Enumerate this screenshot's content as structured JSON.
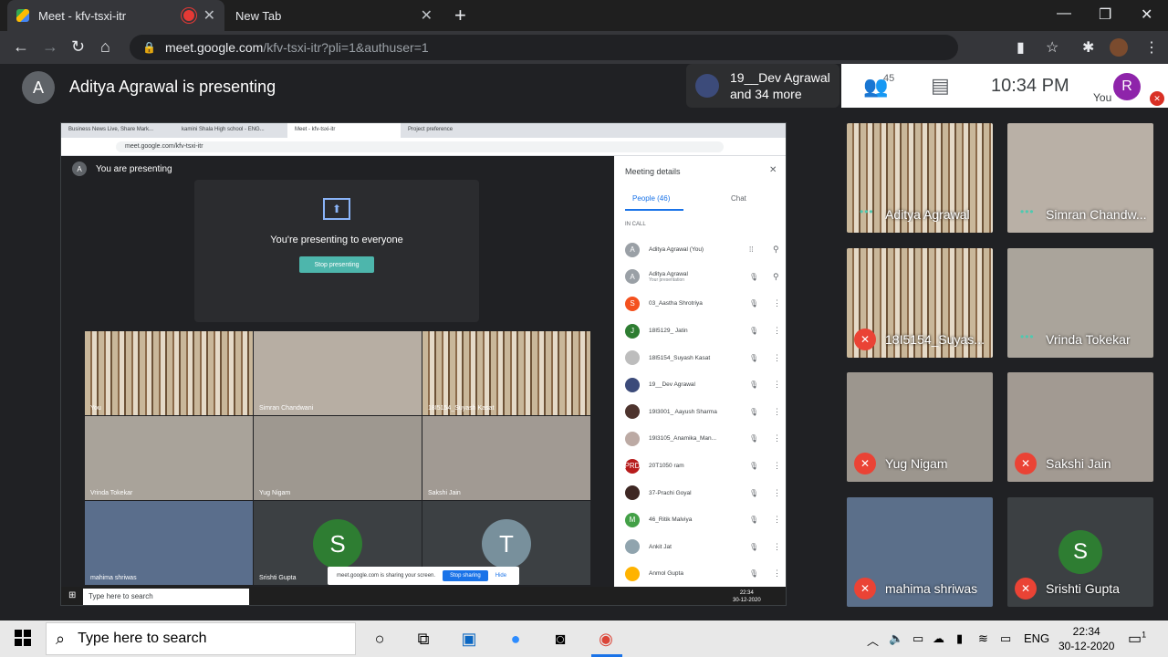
{
  "browser": {
    "tabs": [
      {
        "label": "Meet - kfv-tsxi-itr"
      },
      {
        "label": "New Tab"
      }
    ],
    "new_tab_glyph": "+",
    "url_host": "meet.google.com",
    "url_path": "/kfv-tsxi-itr?pli=1&authuser=1"
  },
  "meet": {
    "presenter_initial": "A",
    "presenting_title": "Aditya Agrawal is presenting",
    "presenter_pill_line1": "19__Dev Agrawal",
    "presenter_pill_line2": "and 34 more",
    "people_count": "45",
    "clock": "10:34 PM",
    "you_label": "You",
    "me_initial": "R"
  },
  "shared_screen": {
    "tabs": [
      "Business News Live, Share Mark...",
      "kamini Shala High school - ENG...",
      "Meet - kfv-tsxi-itr",
      "Project preference"
    ],
    "url": "meet.google.com/kfv-tsxi-itr",
    "you_are_presenting": "You are presenting",
    "you_initial": "A",
    "presenting_to_everyone": "You're presenting to everyone",
    "stop_presenting": "Stop presenting",
    "grid": [
      {
        "label": "You"
      },
      {
        "label": "Simran Chandwani"
      },
      {
        "label": "18I5154_Suyash Kasat"
      },
      {
        "label": "Vrinda Tokekar"
      },
      {
        "label": "Yug Nigam"
      },
      {
        "label": "Sakshi Jain"
      },
      {
        "label": "mahima shriwas"
      },
      {
        "label": "Srishti Gupta",
        "initial": "S"
      },
      {
        "label": "",
        "initial": "T"
      }
    ],
    "sharing_notice": "meet.google.com is sharing your screen.",
    "stop_sharing": "Stop sharing",
    "hide": "Hide",
    "panel": {
      "title": "Meeting details",
      "people_tab": "People (46)",
      "chat_tab": "Chat",
      "in_call": "IN CALL",
      "people": [
        {
          "name": "Aditya Agrawal (You)",
          "sub": "",
          "initial": "A",
          "color": "#9aa0a6"
        },
        {
          "name": "Aditya Agrawal",
          "sub": "Your presentation",
          "initial": "A",
          "color": "#9aa0a6"
        },
        {
          "name": "03_Aastha Shrotriya",
          "sub": "",
          "initial": "S",
          "color": "#f4511e"
        },
        {
          "name": "18I5129_ Jatin",
          "sub": "",
          "initial": "J",
          "color": "#2e7d32"
        },
        {
          "name": "18I5154_Suyash Kasat",
          "sub": "",
          "initial": "",
          "color": "#bdbdbd"
        },
        {
          "name": "19__Dev Agrawal",
          "sub": "",
          "initial": "",
          "color": "#3c4b7a"
        },
        {
          "name": "19I3001_ Aayush Sharma",
          "sub": "",
          "initial": "",
          "color": "#4e342e"
        },
        {
          "name": "19I3105_Anamika_Man...",
          "sub": "",
          "initial": "",
          "color": "#bcaaa4"
        },
        {
          "name": "20T1050 ram",
          "sub": "",
          "initial": "PRD",
          "color": "#b71c1c"
        },
        {
          "name": "37-Prachi Goyal",
          "sub": "",
          "initial": "",
          "color": "#3e2723"
        },
        {
          "name": "46_Ritik Malviya",
          "sub": "",
          "initial": "M",
          "color": "#43a047"
        },
        {
          "name": "Ankit Jat",
          "sub": "",
          "initial": "",
          "color": "#90a4ae"
        },
        {
          "name": "Anmol Gupta",
          "sub": "",
          "initial": "",
          "color": "#ffb300"
        }
      ]
    },
    "taskbar_search": "Type here to search",
    "clock_time": "22:34",
    "clock_date": "30-12-2020"
  },
  "tiles": [
    {
      "name": "Aditya Agrawal",
      "speaking": true
    },
    {
      "name": "Simran Chandw...",
      "speaking": true
    },
    {
      "name": "18I5154_Suyas...",
      "muted": true
    },
    {
      "name": "Vrinda Tokekar",
      "speaking": true
    },
    {
      "name": "Yug Nigam",
      "muted": true
    },
    {
      "name": "Sakshi Jain",
      "muted": true
    },
    {
      "name": "mahima shriwas",
      "muted": true
    },
    {
      "name": "Srishti Gupta",
      "muted": true,
      "initial": "S"
    }
  ],
  "taskbar": {
    "search_placeholder": "Type here to search",
    "language": "ENG",
    "time": "22:34",
    "date": "30-12-2020",
    "notification_count": "1"
  }
}
